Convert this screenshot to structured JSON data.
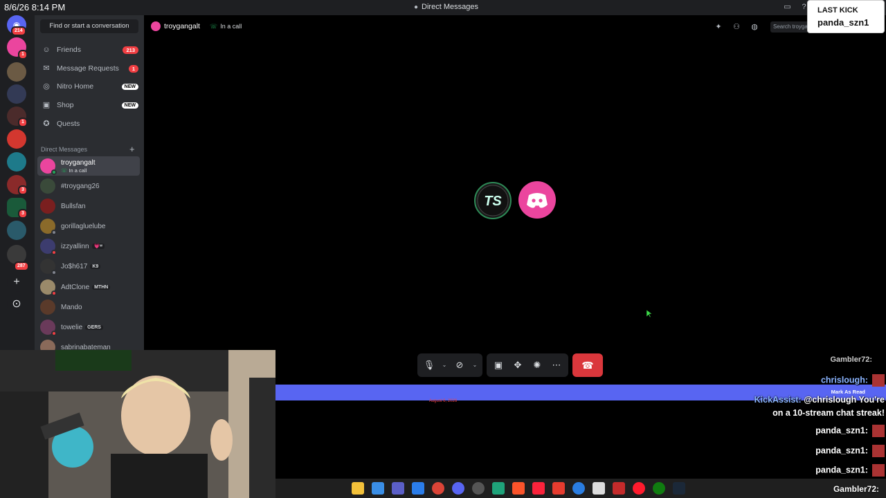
{
  "titlebar": {
    "clock": "8/6/26 8:14 PM",
    "title": "Direct Messages"
  },
  "rail": {
    "home_badge": "214",
    "badges": [
      "1",
      "1",
      "1",
      "3",
      "3",
      "287"
    ]
  },
  "sidebar": {
    "search_label": "Find or start a conversation",
    "nav": [
      {
        "label": "Friends",
        "badge": "213",
        "icon": "friends-icon"
      },
      {
        "label": "Message Requests",
        "badge": "1",
        "icon": "mail-icon"
      },
      {
        "label": "Nitro Home",
        "badge": "NEW",
        "icon": "nitro-icon"
      },
      {
        "label": "Shop",
        "badge": "NEW",
        "icon": "shop-icon"
      },
      {
        "label": "Quests",
        "badge": "",
        "icon": "quests-icon"
      }
    ],
    "dm_header": "Direct Messages",
    "dms": [
      {
        "name": "troygangalt",
        "sub": "In a call",
        "tag": "",
        "color": "#eb459e"
      },
      {
        "name": "#troygang26",
        "sub": "",
        "tag": "",
        "color": "#3a4a3a"
      },
      {
        "name": "Bullsfan",
        "sub": "",
        "tag": "",
        "color": "#7a1f1f"
      },
      {
        "name": "gorillagluelube",
        "sub": "",
        "tag": "",
        "color": "#8a6a2a"
      },
      {
        "name": "izzyallinn",
        "sub": "",
        "tag": "💗ʷ",
        "color": "#3c3c6e"
      },
      {
        "name": "Jo$h617",
        "sub": "",
        "tag": "K9",
        "color": "#333"
      },
      {
        "name": "AdtClone",
        "sub": "",
        "tag": "MTHN",
        "color": "#9a8a6a"
      },
      {
        "name": "Mando",
        "sub": "",
        "tag": "",
        "color": "#5a3a2a"
      },
      {
        "name": "towelie",
        "sub": "",
        "tag": "GERS",
        "color": "#6a3a5a"
      },
      {
        "name": "sabrinabateman",
        "sub": "",
        "tag": "",
        "color": "#8a6a5a"
      }
    ]
  },
  "call": {
    "name": "troygangalt",
    "status": "In a call",
    "search_placeholder": "Search troygangalt"
  },
  "banner": {
    "text": "August 6, 2026",
    "mark_read": "Mark As Read"
  },
  "chat": [
    {
      "user": "Gambler72:",
      "text": ""
    },
    {
      "user": "chrislough:",
      "text": ""
    },
    {
      "user": "KickAssist:",
      "text": "@chrislough You're"
    },
    {
      "user": "",
      "text": "on a 10-stream chat streak!"
    },
    {
      "user": "panda_szn1:",
      "text": ""
    },
    {
      "user": "panda_szn1:",
      "text": ""
    },
    {
      "user": "panda_szn1:",
      "text": ""
    }
  ],
  "gambler_footer": "Gambler72:",
  "last_kick": {
    "title": "LAST KICK",
    "name": "panda_szn1"
  },
  "colors": {
    "accent": "#5865f2",
    "hangup": "#da373c",
    "online": "#23a55a",
    "badge": "#f23f43"
  }
}
